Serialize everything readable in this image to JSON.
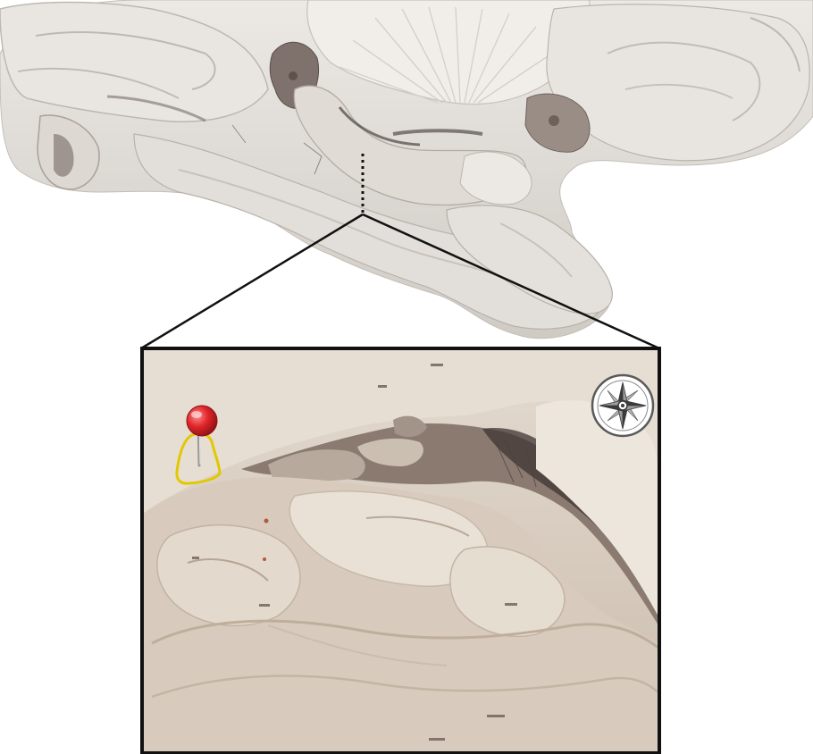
{
  "image": {
    "subject": "",
    "colors": {
      "background": "#ffffff",
      "specimen_light": "#e6e3df",
      "specimen_mid": "#d8d4cf",
      "specimen_shadow": "#b8b2ab",
      "dark_tissue": "#5a4e4a",
      "inset_bg": "#d9cfc3",
      "inset_light": "#e9e2d8",
      "inset_shadow": "#8c7d72",
      "frame": "#111111",
      "pin_head": "#d9262a",
      "pin_outline": "#e2c800",
      "compass_ring": "#5a5a5a"
    },
    "icons": {
      "location_pin": "map-pin-icon",
      "compass": "compass-icon"
    }
  }
}
